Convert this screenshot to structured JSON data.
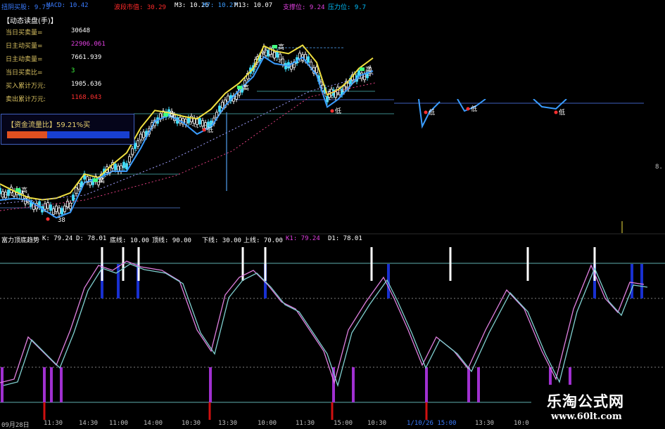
{
  "header": {
    "items": [
      {
        "label": "扭阴买股:",
        "value": "9.73",
        "color": "#3a7cff"
      },
      {
        "label": "MACD:",
        "value": "10.42",
        "color": "#3a7cff"
      },
      {
        "label": "波段市值:",
        "value": "30.29",
        "color": "#ff2a2a"
      },
      {
        "label": "M3:",
        "value": "10.26",
        "color": "#ffffff"
      },
      {
        "label": "M7:",
        "value": "10.27",
        "color": "#3a9cff"
      },
      {
        "label": "M13:",
        "value": "10.07",
        "color": "#ffffff"
      },
      {
        "label": "支撑位:",
        "value": "9.24",
        "color": "#e040e0"
      },
      {
        "label": "压力位:",
        "value": "9.7",
        "color": "#00c0ff"
      }
    ]
  },
  "panel": {
    "title": "【动态读盘(手)】",
    "rows": [
      {
        "label": "当日买卖量=",
        "value": "30648",
        "color": "#ffffff"
      },
      {
        "label": "日主动买量=",
        "value": "22906.061",
        "color": "#e040e0"
      },
      {
        "label": "日主动卖量=",
        "value": "7661.939",
        "color": "#ffffff"
      },
      {
        "label": "当日买卖比=",
        "value": "3",
        "color": "#40ff40"
      },
      {
        "label": "买入累计万元:",
        "value": "1905.636",
        "color": "#ffffff"
      },
      {
        "label": "卖出累计万元:",
        "value": "1168.043",
        "color": "#ff3030"
      }
    ],
    "flow": {
      "label": "【资金流量比】59.21%买",
      "percent": 59.21
    }
  },
  "markers": {
    "high": "高",
    "low": "低",
    "price_label": "38"
  },
  "right_tick": "8.",
  "lower_header": {
    "items": [
      {
        "label": "富力顶底趋势",
        "value": "",
        "color": "#ffffff"
      },
      {
        "label": "K:",
        "value": "79.24",
        "color": "#ffffff"
      },
      {
        "label": "D:",
        "value": "78.01",
        "color": "#ffffff"
      },
      {
        "label": "底线:",
        "value": "10.00",
        "color": "#ffffff"
      },
      {
        "label": "顶线:",
        "value": "90.00",
        "color": "#ffffff"
      },
      {
        "label": "下线:",
        "value": "30.00",
        "color": "#ffffff"
      },
      {
        "label": "上线:",
        "value": "70.00",
        "color": "#ffffff"
      },
      {
        "label": "K1:",
        "value": "79.24",
        "color": "#e040e0"
      },
      {
        "label": "D1:",
        "value": "78.01",
        "color": "#ffffff"
      }
    ]
  },
  "xaxis": [
    "09月28日",
    "11:30",
    "14:30",
    "11:00",
    "14:00",
    "10:30",
    "13:30",
    "10:00",
    "11:30",
    "15:00",
    "10:30",
    "1/10/26 15:00",
    "13:30",
    "10:0"
  ],
  "watermark": {
    "name": "乐淘公式网",
    "url": "www.60lt.com"
  },
  "colors": {
    "background": "#000000",
    "k_line": "#e080e0",
    "d_line": "#80d0d0",
    "top_bar": "#1830d0",
    "bottom_bar": "#a030d0",
    "white_bar": "#ffffff",
    "red_bar": "#d01010"
  }
}
